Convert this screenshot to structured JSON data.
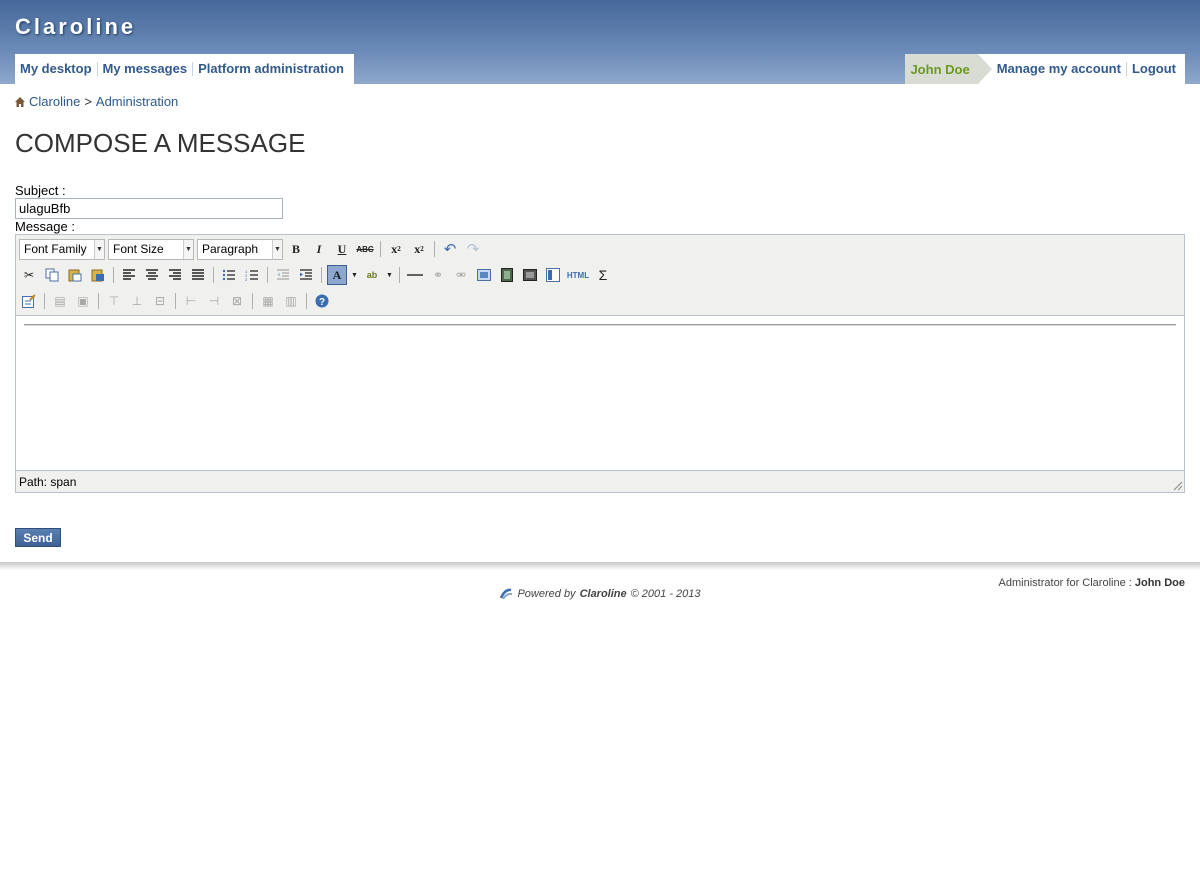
{
  "header": {
    "site_name": "Claroline",
    "nav": [
      "My desktop",
      "My messages",
      "Platform administration"
    ],
    "user_name": "John Doe",
    "manage_account": "Manage my account",
    "logout": "Logout"
  },
  "breadcrumb": {
    "home": "Claroline",
    "separator": ">",
    "current": "Administration"
  },
  "page_title": "COMPOSE A MESSAGE",
  "form": {
    "subject_label": "Subject :",
    "subject_value": "ulaguBfb",
    "message_label": "Message :",
    "send_label": "Send"
  },
  "editor": {
    "font_family": "Font Family",
    "font_size": "Font Size",
    "format": "Paragraph",
    "status_path": "Path: span",
    "html_button": "HTML",
    "strike_button": "ABC"
  },
  "footer": {
    "admin_prefix": "Administrator for Claroline",
    "admin_name": "John Doe",
    "powered_prefix": "Powered by",
    "powered_brand": "Claroline",
    "powered_suffix": "© 2001 - 2013"
  },
  "colors": {
    "header": "#45689a",
    "link": "#325a8c",
    "user_tab": "#6a9a20",
    "send": "#3e6295"
  }
}
